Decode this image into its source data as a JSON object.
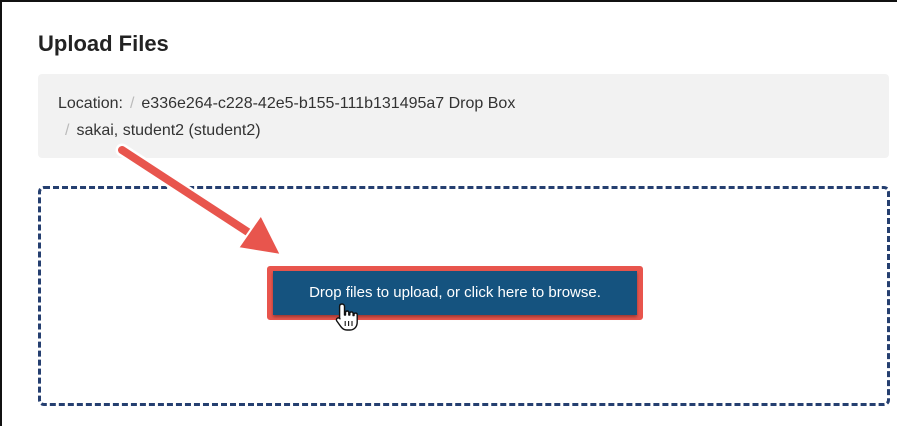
{
  "header": {
    "title": "Upload Files"
  },
  "location": {
    "label": "Location:",
    "separator": "/",
    "path": [
      "e336e264-c228-42e5-b155-111b131495a7 Drop Box",
      "sakai, student2 (student2)"
    ]
  },
  "drop_zone": {
    "button_label": "Drop files to upload, or click here to browse."
  },
  "annotation": {
    "arrow_icon": "arrow-icon",
    "cursor_icon": "hand-pointer-icon"
  },
  "colors": {
    "title_text": "#222222",
    "location_background": "#f2f2f2",
    "separator": "#bbbbbb",
    "drop_zone_border": "#253f70",
    "button_background": "#15537f",
    "button_text": "#ffffff",
    "highlight": "#e8554d"
  }
}
